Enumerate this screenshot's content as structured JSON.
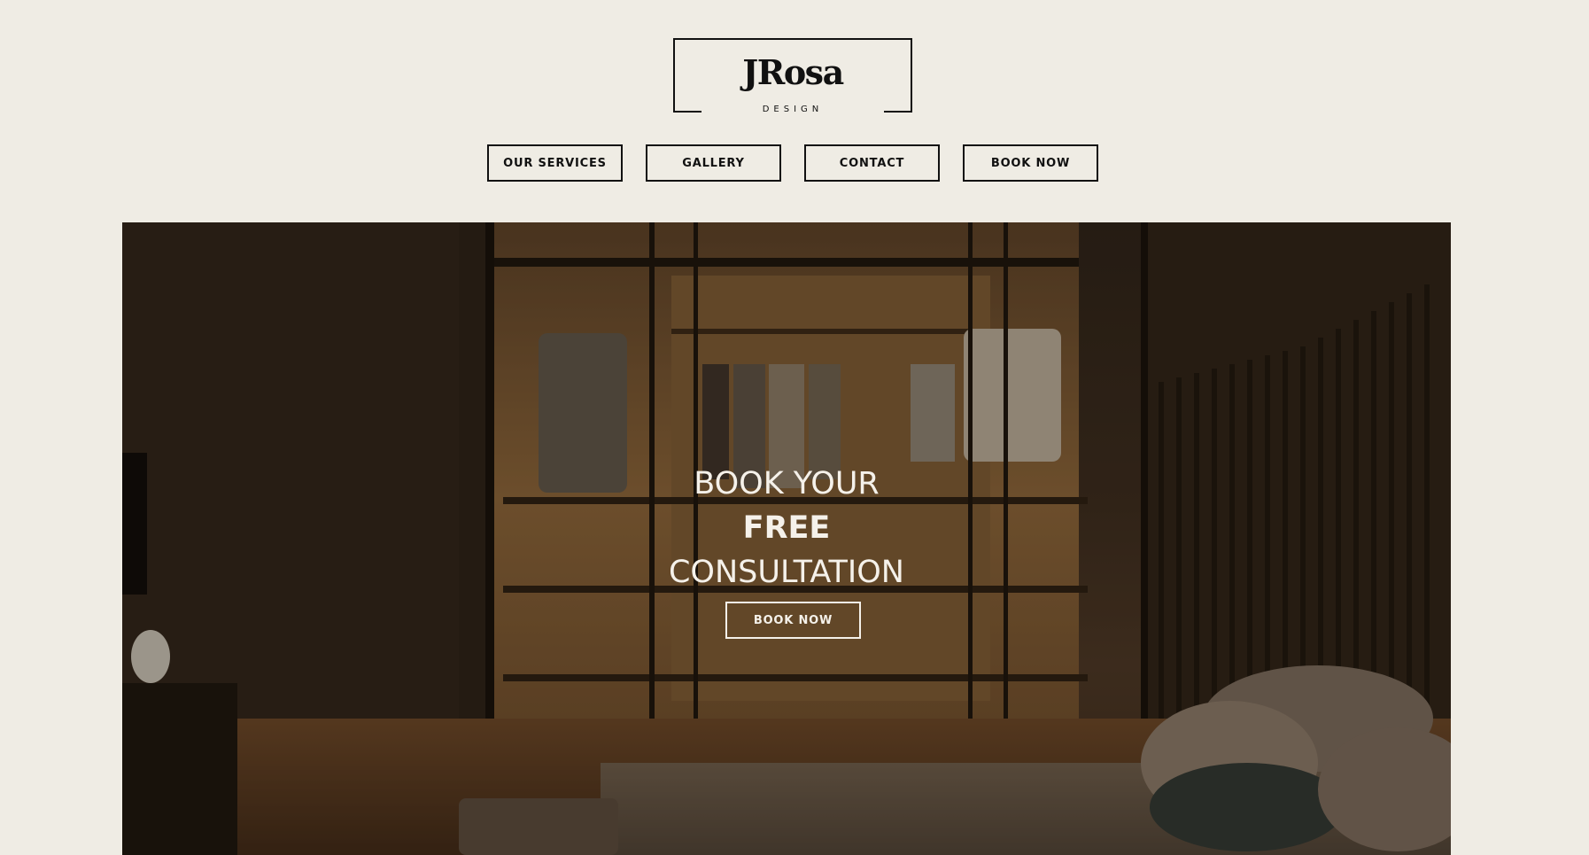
{
  "brand": {
    "name": "JRosa",
    "tagline": "DESIGN"
  },
  "nav": {
    "items": [
      {
        "label": "OUR SERVICES"
      },
      {
        "label": "GALLERY"
      },
      {
        "label": "CONTACT"
      },
      {
        "label": "BOOK NOW"
      }
    ]
  },
  "hero": {
    "line1": "BOOK YOUR",
    "line2": "FREE",
    "line3": "CONSULTATION",
    "button_label": "BOOK NOW",
    "image_subject": "walk-in closet bedroom interior"
  },
  "colors": {
    "background": "#efece4",
    "text": "#111111",
    "hero_text": "#f5f1ea"
  }
}
